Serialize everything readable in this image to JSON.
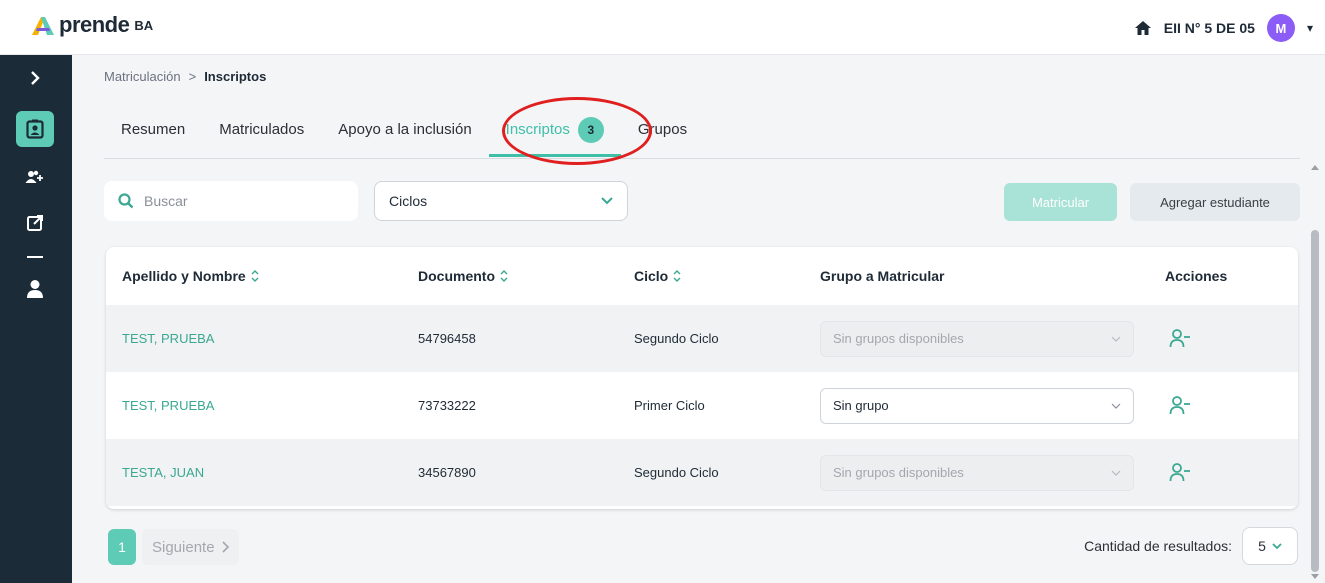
{
  "app": {
    "logo_text": "prende",
    "logo_badge": "BA"
  },
  "header": {
    "school": "EII N° 5 DE 05",
    "avatar_initial": "M"
  },
  "breadcrumb": {
    "parent": "Matriculación",
    "separator": ">",
    "current": "Inscriptos"
  },
  "tabs": [
    {
      "label": "Resumen"
    },
    {
      "label": "Matriculados"
    },
    {
      "label": "Apoyo a la inclusión"
    },
    {
      "label": "Inscriptos",
      "badge": "3",
      "active": true
    },
    {
      "label": "Grupos"
    }
  ],
  "filters": {
    "search_placeholder": "Buscar",
    "ciclos_label": "Ciclos"
  },
  "actions": {
    "matricular": "Matricular",
    "agregar": "Agregar estudiante"
  },
  "table": {
    "headers": {
      "name": "Apellido y Nombre",
      "document": "Documento",
      "cycle": "Ciclo",
      "group": "Grupo a Matricular",
      "actions": "Acciones"
    },
    "rows": [
      {
        "name": "TEST, PRUEBA",
        "document": "54796458",
        "cycle": "Segundo Ciclo",
        "group": "Sin grupos disponibles",
        "group_enabled": false
      },
      {
        "name": "TEST, PRUEBA",
        "document": "73733222",
        "cycle": "Primer Ciclo",
        "group": "Sin grupo",
        "group_enabled": true
      },
      {
        "name": "TESTA, JUAN",
        "document": "34567890",
        "cycle": "Segundo Ciclo",
        "group": "Sin grupos disponibles",
        "group_enabled": false
      }
    ]
  },
  "pagination": {
    "page": "1",
    "next": "Siguiente",
    "results_label": "Cantidad de resultados:",
    "results_value": "5"
  },
  "colors": {
    "accent": "#5dcbb5",
    "sidebar": "#1c2b38",
    "annotation": "#e01f1f"
  }
}
